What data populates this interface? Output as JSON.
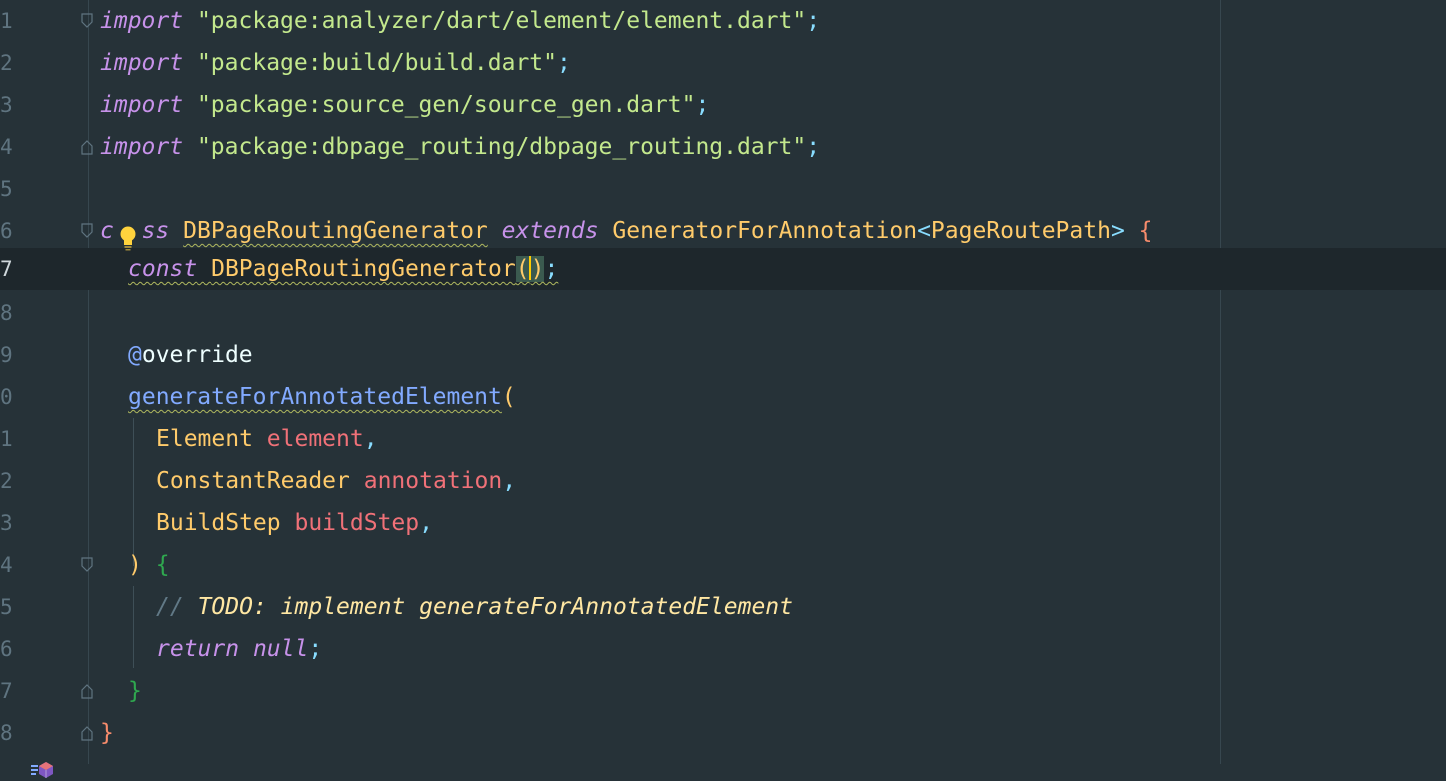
{
  "editor": {
    "language": "Dart",
    "current_line": "7",
    "line_numbers": [
      "1",
      "2",
      "3",
      "4",
      "5",
      "6",
      "7",
      "8",
      "9",
      "0",
      "1",
      "2",
      "3",
      "4",
      "5",
      "6",
      "7",
      "8"
    ],
    "lines": {
      "l1": {
        "kw": "import",
        "str": "\"package:analyzer/dart/element/element.dart\"",
        "end": ";"
      },
      "l2": {
        "kw": "import",
        "str": "\"package:build/build.dart\"",
        "end": ";"
      },
      "l3": {
        "kw": "import",
        "str": "\"package:source_gen/source_gen.dart\"",
        "end": ";"
      },
      "l4": {
        "kw": "import",
        "str": "\"package:dbpage_routing/dbpage_routing.dart\"",
        "end": ";"
      },
      "l6": {
        "kw_class_a": "c",
        "kw_class_b": "ss",
        "name": "DBPageRoutingGenerator",
        "kw_extends": "extends",
        "base": "GeneratorForAnnotation",
        "lt": "<",
        "type_arg": "PageRoutePath",
        "gt": ">",
        "brace": "{"
      },
      "l7": {
        "kw": "const",
        "name": "DBPageRoutingGenerator",
        "open": "(",
        "close": ")",
        "end": ";"
      },
      "l9": {
        "at": "@",
        "name": "override"
      },
      "l10": {
        "name": "generateForAnnotatedElement",
        "open": "("
      },
      "l11": {
        "type": "Element",
        "param": "element",
        "comma": ","
      },
      "l12": {
        "type": "ConstantReader",
        "param": "annotation",
        "comma": ","
      },
      "l13": {
        "type": "BuildStep",
        "param": "buildStep",
        "comma": ","
      },
      "l14": {
        "close": ")",
        "brace": "{"
      },
      "l15": {
        "slashes": "//",
        "todo": "TODO: implement generateForAnnotatedElement"
      },
      "l16": {
        "kw_return": "return",
        "kw_null": "null",
        "end": ";"
      },
      "l17": {
        "brace": "}"
      },
      "l18": {
        "brace": "}"
      }
    }
  },
  "icons": {
    "intention_bulb": "lightbulb-icon",
    "implements_marker": "override-method-gutter-icon",
    "fold": "fold-marker-icon"
  },
  "colors": {
    "background": "#263238",
    "current_line": "#1e272c",
    "keyword": "#c792ea",
    "string": "#c3e88d",
    "class": "#ffcb6b",
    "punctuation": "#89ddff",
    "parameter": "#f07178",
    "function": "#82aaff"
  }
}
